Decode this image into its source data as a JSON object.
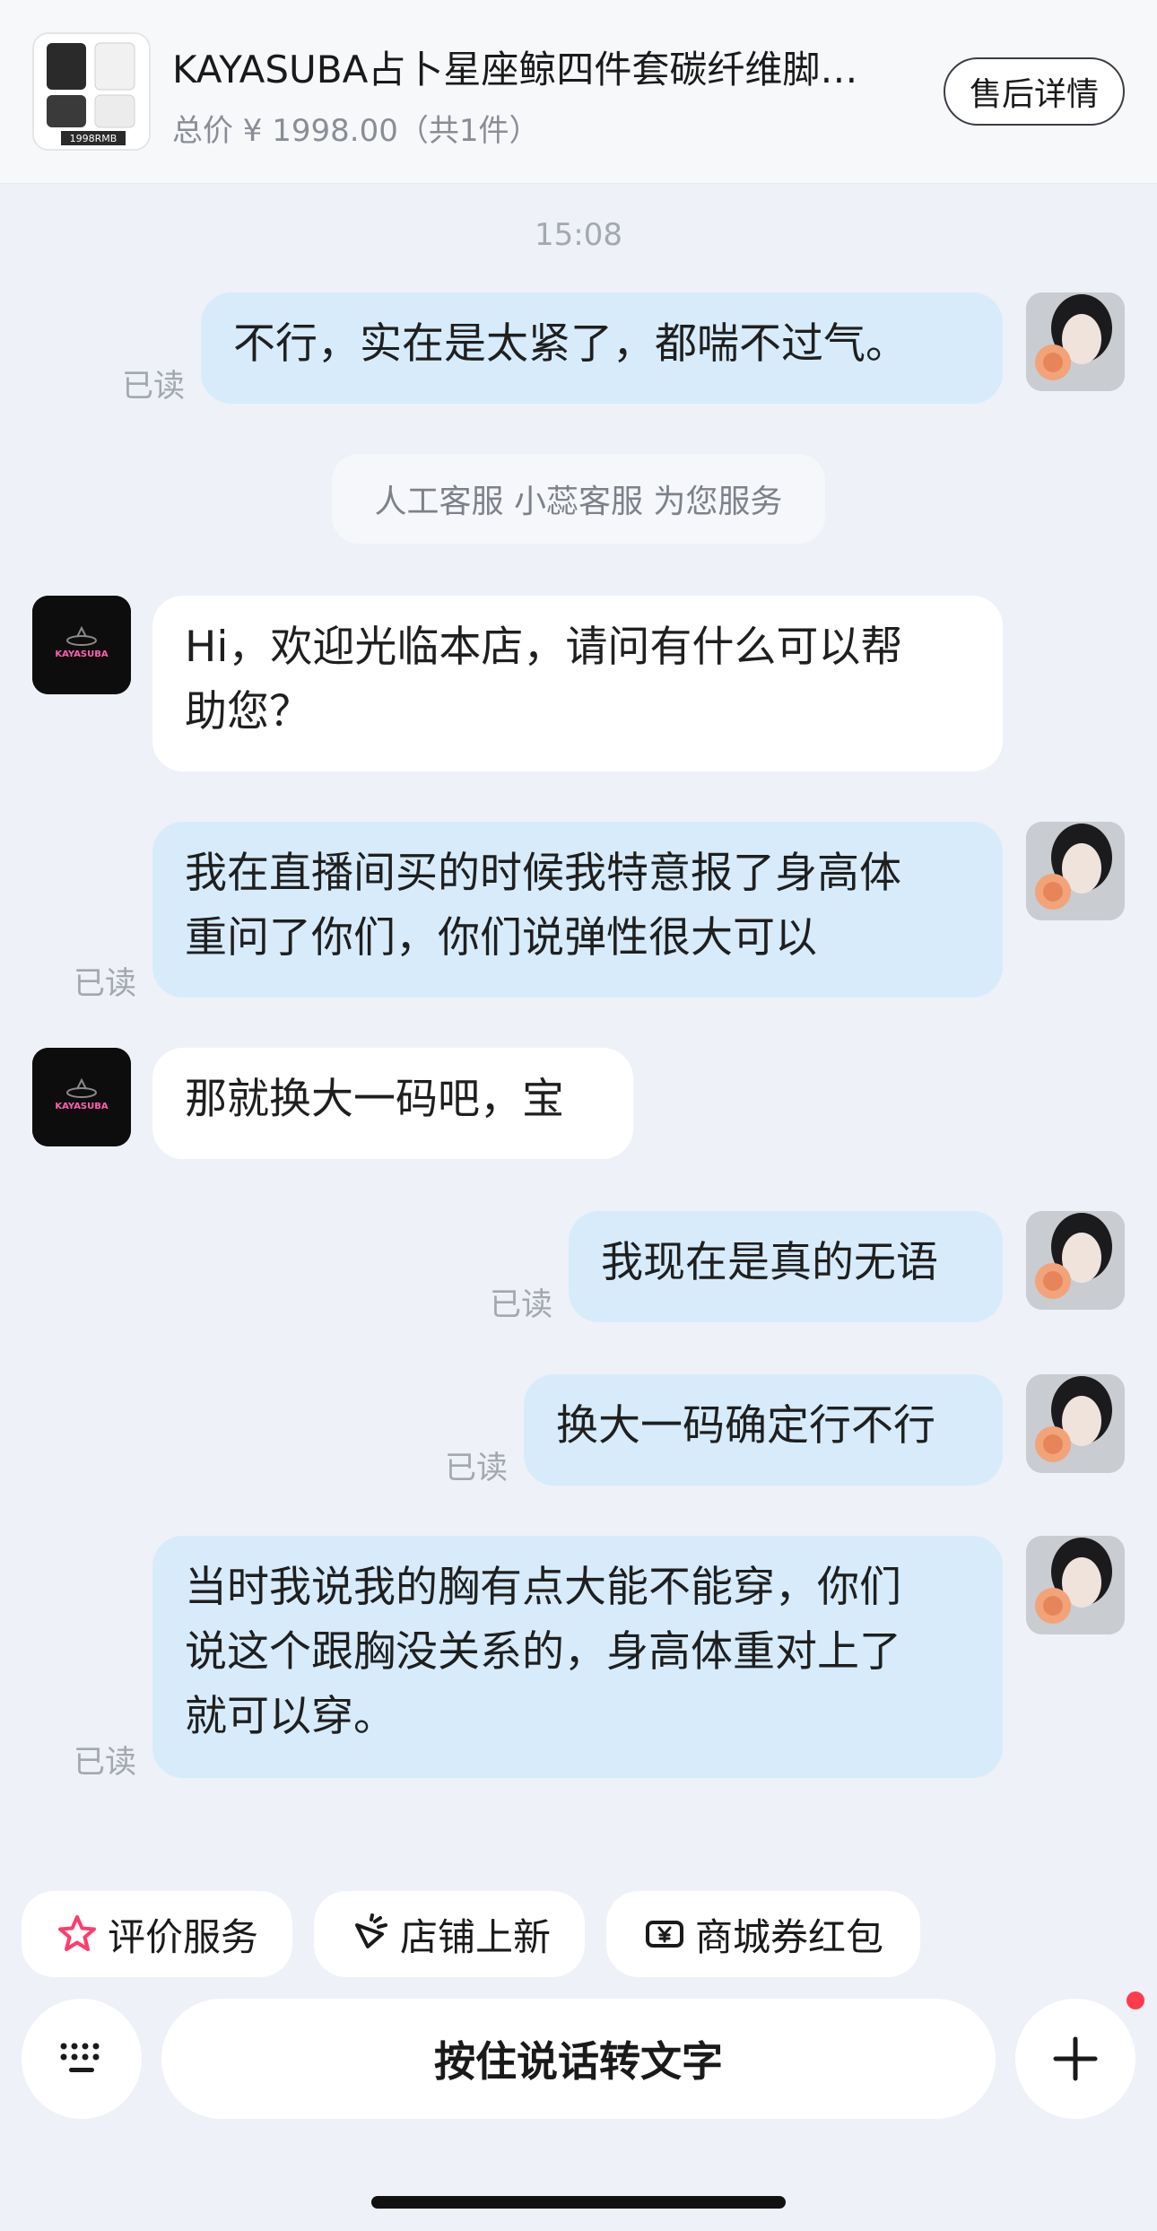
{
  "header": {
    "product_title": "KAYASUBA占卜星座鲸四件套碳纤维脚…",
    "price_text": "总价 ¥ 1998.00（共1件）",
    "thumb_label": "1998RMB",
    "after_sales_label": "售后详情"
  },
  "chat": {
    "time": "15:08",
    "system_notice": "人工客服 小蕊客服 为您服务",
    "shop_logo_text": "KAYASUBA",
    "read_label": "已读",
    "messages": [
      {
        "text": "不行，实在是太紧了，都喘不过气。"
      },
      {
        "line1": "Hi，欢迎光临本店，请问有什么可以帮",
        "line2": "助您？"
      },
      {
        "line1": "我在直播间买的时候我特意报了身高体",
        "line2": "重问了你们，你们说弹性很大可以"
      },
      {
        "text": "那就换大一码吧，宝"
      },
      {
        "text": "我现在是真的无语"
      },
      {
        "text": "换大一码确定行不行"
      },
      {
        "line1": "当时我说我的胸有点大能不能穿，你们",
        "line2": "说这个跟胸没关系的，身高体重对上了",
        "line3": "就可以穿。"
      }
    ]
  },
  "quick_actions": [
    {
      "label": "评价服务",
      "icon": "star-icon"
    },
    {
      "label": "店铺上新",
      "icon": "new-arrival-icon"
    },
    {
      "label": "商城券红包",
      "icon": "coupon-icon"
    }
  ],
  "input_bar": {
    "voice_label": "按住说话转文字",
    "keyboard_icon": "keyboard-icon",
    "plus_icon": "plus-icon"
  },
  "colors": {
    "my_bubble": "#d7ebfb",
    "shop_bubble": "#ffffff",
    "background": "#eef1f7",
    "accent_red": "#ff3b4e"
  }
}
